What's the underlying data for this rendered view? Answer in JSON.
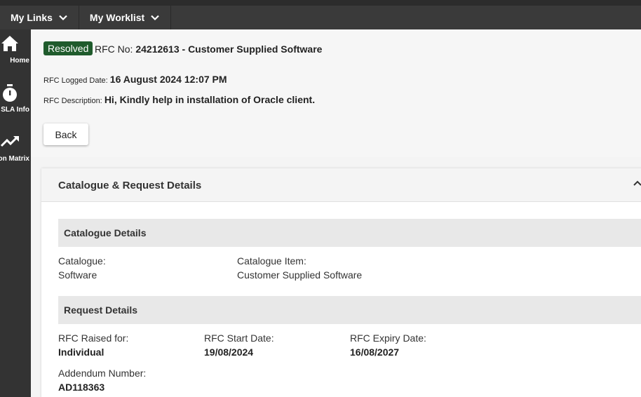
{
  "topnav": {
    "items": [
      {
        "label": "My Links"
      },
      {
        "label": "My Worklist"
      }
    ]
  },
  "sidebar": {
    "items": [
      {
        "label": "Home",
        "icon": "home-icon"
      },
      {
        "label": "SLA Info",
        "icon": "stopwatch-icon"
      },
      {
        "label": "Escalation Matrix",
        "icon": "trending-up-icon"
      }
    ]
  },
  "header": {
    "status": "Resolved",
    "rfc_prefix": "RFC No:",
    "rfc_title": "24212613 - Customer Supplied Software",
    "logged_label": "RFC Logged Date:",
    "logged_value": "16 August 2024 12:07 PM",
    "desc_label": "RFC Description:",
    "desc_value": "Hi, Kindly help in installation of Oracle client.",
    "back_label": "Back"
  },
  "panel": {
    "title": "Catalogue & Request Details",
    "catalogue_section": {
      "title": "Catalogue Details",
      "fields": [
        {
          "label": "Catalogue:",
          "value": "Software"
        },
        {
          "label": "Catalogue Item:",
          "value": "Customer Supplied Software"
        }
      ]
    },
    "request_section": {
      "title": "Request Details",
      "fields": [
        {
          "label": "RFC Raised for:",
          "value": "Individual"
        },
        {
          "label": "RFC Start Date:",
          "value": "19/08/2024"
        },
        {
          "label": "RFC Expiry Date:",
          "value": "16/08/2027"
        },
        {
          "label": "Addendum Number:",
          "value": "AD118363"
        }
      ]
    }
  },
  "colors": {
    "status_badge": "#1f5b2c",
    "topnav_bg": "#3a3a3a",
    "sidebar_bg": "#333333"
  }
}
